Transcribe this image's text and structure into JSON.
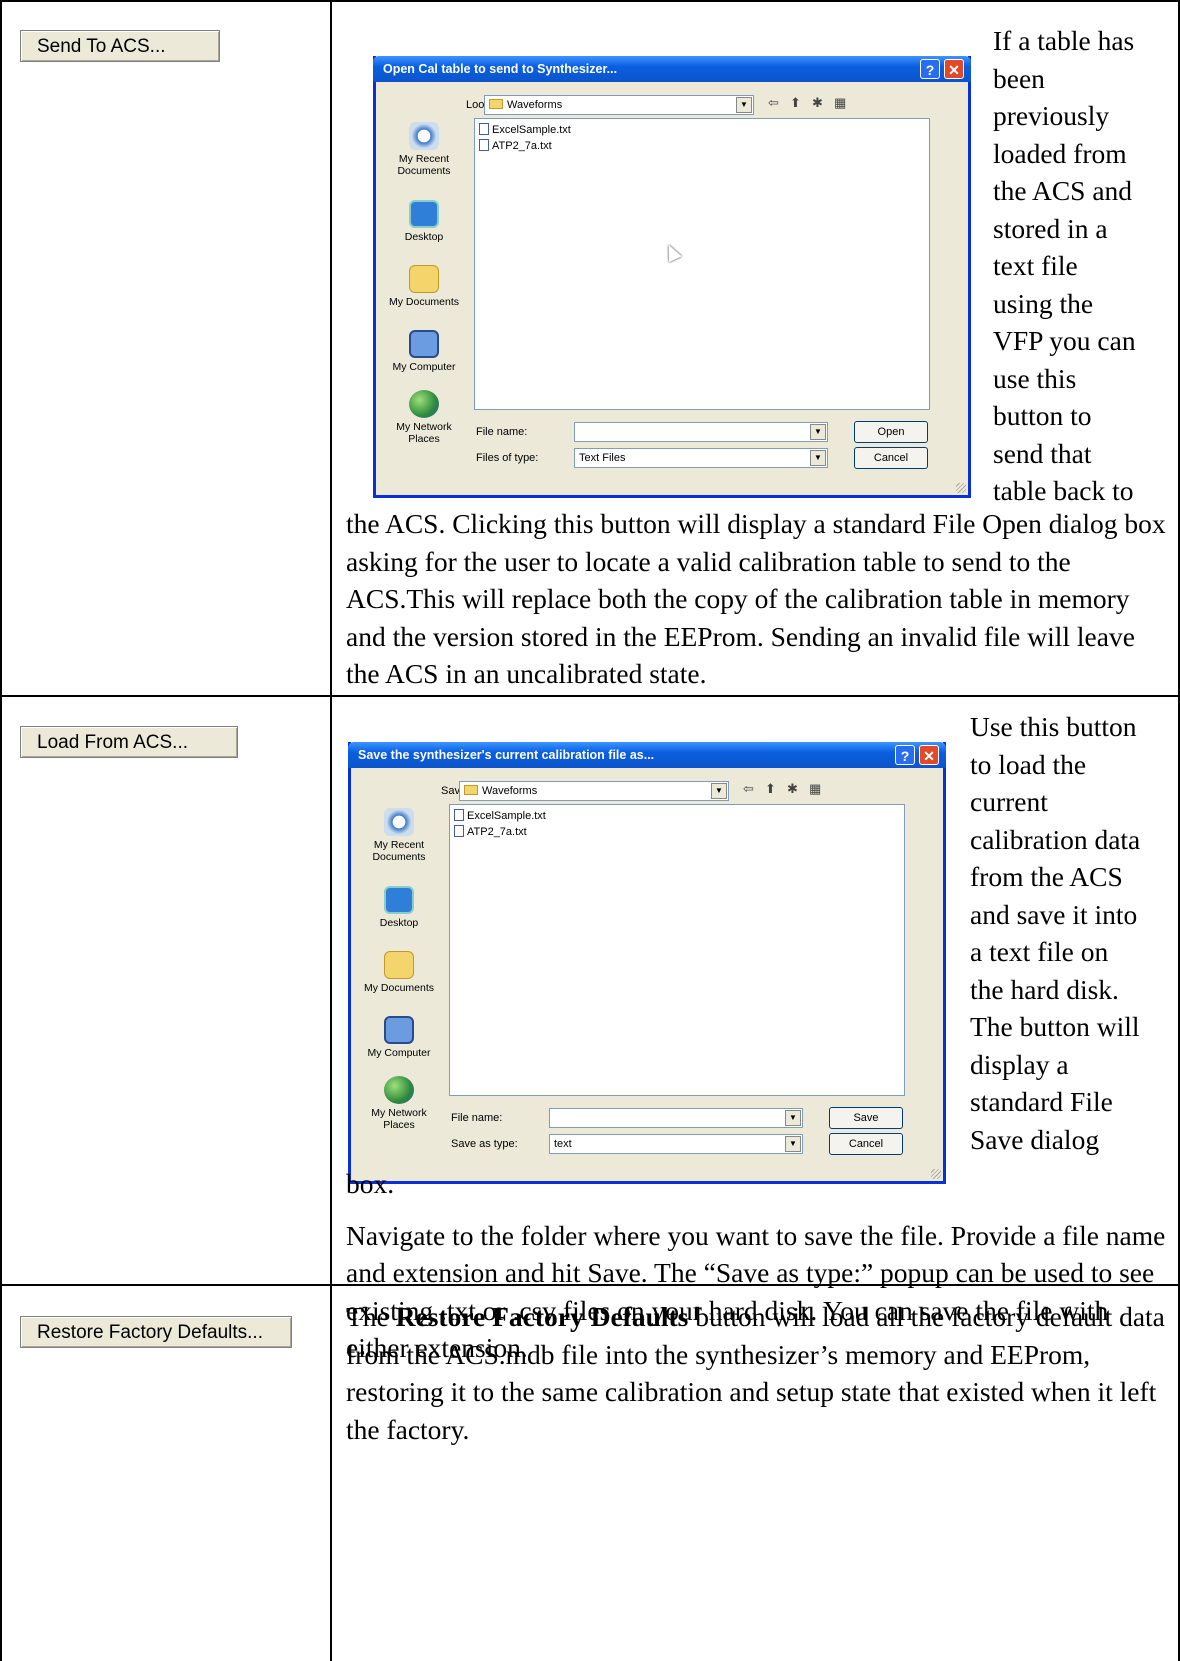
{
  "rows": [
    {
      "button_label": "Send To ACS...",
      "dialog": {
        "title": "Open Cal table to send to Synthesizer...",
        "help_glyph": "?",
        "close_glyph": "✕",
        "location_label": "Look in:",
        "location_value": "Waveforms",
        "places": [
          "My Recent Documents",
          "Desktop",
          "My Documents",
          "My Computer",
          "My Network Places"
        ],
        "files": [
          "ExcelSample.txt",
          "ATP2_7a.txt"
        ],
        "file_name_label": "File name:",
        "file_name_value": "",
        "type_label": "Files of type:",
        "type_value": "Text Files",
        "primary_button": "Open",
        "cancel_button": "Cancel"
      },
      "side_text": [
        "If a table has",
        "been",
        "previously",
        "loaded from",
        "the ACS and",
        "stored in a",
        "text file",
        "using the",
        "VFP you can",
        "use this",
        "button to",
        "send that",
        "table back to"
      ],
      "paragraphs": [
        "the ACS. Clicking this button will display a standard File Open dialog box asking for the user to locate a valid calibration table to send to the ACS.This will replace both the copy of the calibration table in memory and the version stored in the EEProm. Sending an invalid file will leave the ACS in an uncalibrated state."
      ]
    },
    {
      "button_label": "Load From ACS...",
      "dialog": {
        "title": "Save the synthesizer's current calibration file as...",
        "help_glyph": "?",
        "close_glyph": "✕",
        "location_label": "Save in:",
        "location_value": "Waveforms",
        "places": [
          "My Recent Documents",
          "Desktop",
          "My Documents",
          "My Computer",
          "My Network Places"
        ],
        "files": [
          "ExcelSample.txt",
          "ATP2_7a.txt"
        ],
        "file_name_label": "File name:",
        "file_name_value": "",
        "type_label": "Save as type:",
        "type_value": "text",
        "primary_button": "Save",
        "cancel_button": "Cancel"
      },
      "side_text": [
        "Use this button",
        "to load the",
        "current",
        "calibration data",
        "from the ACS",
        "and save it into",
        "a text file on",
        "the hard disk.",
        "The button will",
        "display a",
        "standard File",
        "Save dialog"
      ],
      "paragraphs": [
        "box.",
        "Navigate to the folder where you want to save the file. Provide a file name and extension and hit Save. The “Save as type:” popup can be used to see existing .txt or .csv files on your hard disk. You can save the file with either extension."
      ]
    },
    {
      "button_label": "Restore Factory Defaults...",
      "text_before": "The ",
      "text_bold": "Restore Factory Defaults",
      "text_after": " button will load all the factory default data from the ACS.mdb file into the synthesizer’s memory and EEProm, restoring it to the same calibration and setup state that existed when it left the factory."
    }
  ]
}
